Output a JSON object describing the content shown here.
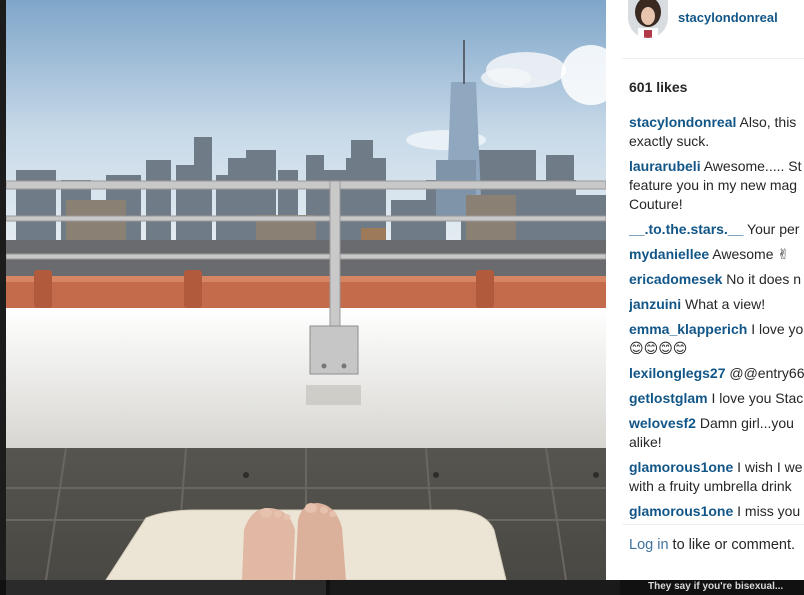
{
  "header": {
    "username": "stacylondonreal",
    "avatar_icon": "profile-photo"
  },
  "post": {
    "likes": "601 likes"
  },
  "comments": [
    {
      "user": "stacylondonreal",
      "lines": [
        "Also, this",
        "exactly suck."
      ]
    },
    {
      "user": "laurarubeli",
      "lines": [
        "Awesome..... St",
        "feature you in my new mag",
        "Couture!"
      ]
    },
    {
      "user": "__.to.the.stars.__",
      "lines": [
        "Your per"
      ]
    },
    {
      "user": "mydaniellee",
      "lines": [
        "Awesome ✌"
      ]
    },
    {
      "user": "ericadomesek",
      "lines": [
        "No it does n"
      ]
    },
    {
      "user": "janzuini",
      "lines": [
        "What a view!"
      ]
    },
    {
      "user": "emma_klapperich",
      "lines": [
        "I love yo",
        "😊😊😊😊"
      ]
    },
    {
      "user": "lexilonglegs27",
      "lines": [
        "@@entry66"
      ]
    },
    {
      "user": "getlostglam",
      "lines": [
        "I love you Stac"
      ]
    },
    {
      "user": "welovesf2",
      "lines": [
        "Damn girl...you",
        "alike!"
      ]
    },
    {
      "user": "glamorous1one",
      "lines": [
        "I wish I we",
        "with a fruity umbrella drink"
      ]
    },
    {
      "user": "glamorous1one",
      "lines": [
        "I miss you"
      ]
    }
  ],
  "footer": {
    "login_link": "Log in",
    "login_suffix": " to like or comment."
  },
  "bottom_strip": {
    "caption": "They say if you're bisexual..."
  },
  "colors": {
    "username": "#125688",
    "link": "#3f729b",
    "text": "#262626",
    "divider": "#efefef"
  }
}
